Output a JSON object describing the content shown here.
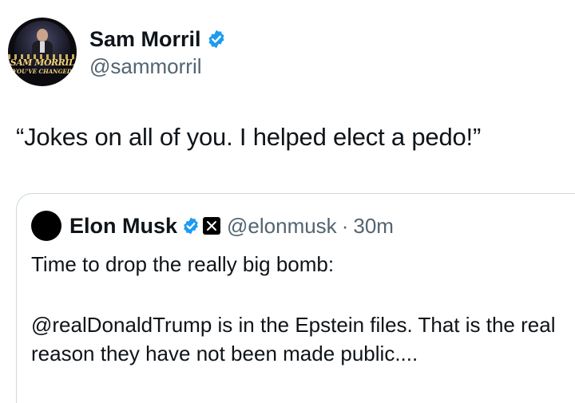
{
  "author": {
    "display_name": "Sam Morril",
    "handle": "@sammorril",
    "verified": true,
    "avatar": {
      "title_line1": "SAM MORRIL",
      "title_line2": "YOU'VE CHANGED"
    }
  },
  "tweet": {
    "text": "“Jokes on all of you. I helped elect a pedo!”"
  },
  "quoted": {
    "display_name": "Elon Musk",
    "handle": "@elonmusk",
    "separator": "·",
    "time": "30m",
    "line1": "Time to drop the really big bomb:",
    "paragraph2": "@realDonaldTrump is in the Epstein files. That is the real reason they have not been made public...."
  },
  "colors": {
    "verified_blue": "#1d9bf0",
    "secondary_text": "#536471",
    "border": "#cfd9de"
  },
  "icons": [
    "verified-badge-icon",
    "x-affiliate-icon"
  ]
}
